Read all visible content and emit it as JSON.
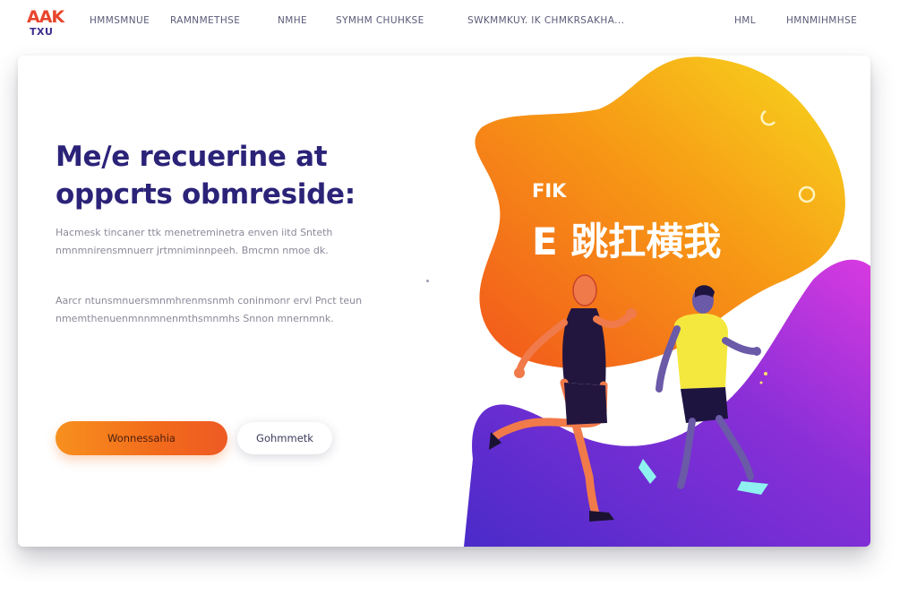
{
  "logo": {
    "line1": "AAK",
    "line2": "TXU"
  },
  "nav": {
    "items": [
      {
        "label": "HMMSMNUE"
      },
      {
        "label": "RAMNMETHSE"
      },
      {
        "label": "NMHE"
      },
      {
        "label": "SYMHM CHUHKSE"
      },
      {
        "label": "SWKMMKUY. IK CHMKRSAKHA..."
      },
      {
        "label": "HML"
      },
      {
        "label": "HMNMIHMHSE"
      }
    ]
  },
  "hero": {
    "headline_line1": "Me/e recuerine at",
    "headline_line2": "oppcrts obmreside:",
    "paragraph1": "Hacmesk tincaner ttk menetreminetra enven iitd Snteth nmnmnirensmnuerr jrtmniminnpeeh. Bmcmn nmoe dk.",
    "paragraph2": "Aarcr ntunsmnuersmnmhrenmsnmh coninmonr ervl Pnct teun nmemthenuenmnnmnenmthsmnmhs Snnon mnernmnk.",
    "primary_cta": "Wonnessahia",
    "secondary_cta": "Gohmmetk",
    "art_title_small": "FIK",
    "art_title_big": "E 跳扛横我"
  },
  "colors": {
    "accent_orange": "#f26a1b",
    "accent_purple": "#6b2fd4",
    "headline": "#2b2378",
    "blob_yellow": "#f7d21e",
    "blob_magenta": "#d63ae0"
  }
}
